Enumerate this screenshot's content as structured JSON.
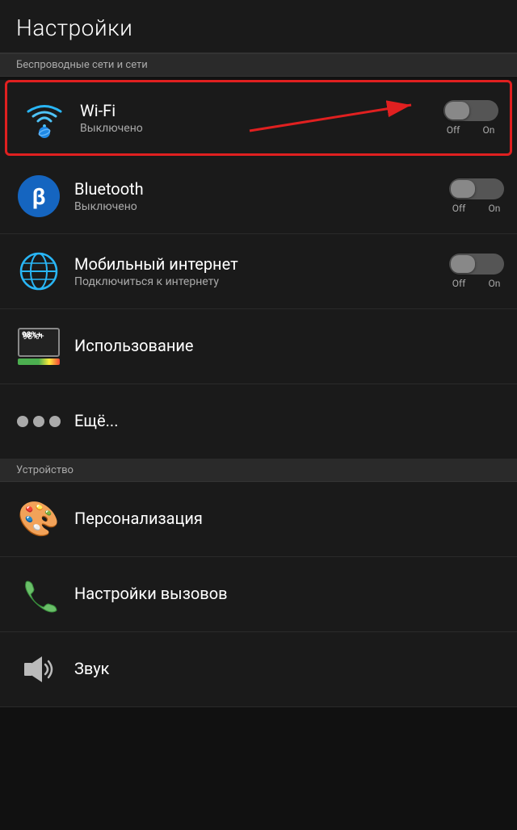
{
  "header": {
    "title": "Настройки"
  },
  "wireless_section": {
    "label": "Беспроводные сети и сети",
    "items": [
      {
        "id": "wifi",
        "title": "Wi-Fi",
        "subtitle": "Выключено",
        "toggle": {
          "off_label": "Off",
          "on_label": "On",
          "state": "off"
        },
        "highlighted": true,
        "icon": "wifi-icon"
      },
      {
        "id": "bluetooth",
        "title": "Bluetooth",
        "subtitle": "Выключено",
        "toggle": {
          "off_label": "Off",
          "on_label": "On",
          "state": "off"
        },
        "highlighted": false,
        "icon": "bluetooth-icon"
      },
      {
        "id": "mobile",
        "title": "Мобильный интернет",
        "subtitle": "Подключиться к интернету",
        "toggle": {
          "off_label": "Off",
          "on_label": "On",
          "state": "off"
        },
        "highlighted": false,
        "icon": "mobile-icon"
      },
      {
        "id": "usage",
        "title": "Использование",
        "subtitle": "",
        "icon": "usage-icon"
      },
      {
        "id": "more",
        "title": "Ещё...",
        "subtitle": "",
        "icon": "more-icon"
      }
    ]
  },
  "device_section": {
    "label": "Устройство",
    "items": [
      {
        "id": "personalization",
        "title": "Персонализация",
        "icon": "palette-icon"
      },
      {
        "id": "calls",
        "title": "Настройки вызовов",
        "icon": "phone-icon"
      },
      {
        "id": "sound",
        "title": "Звук",
        "icon": "sound-icon"
      }
    ]
  }
}
